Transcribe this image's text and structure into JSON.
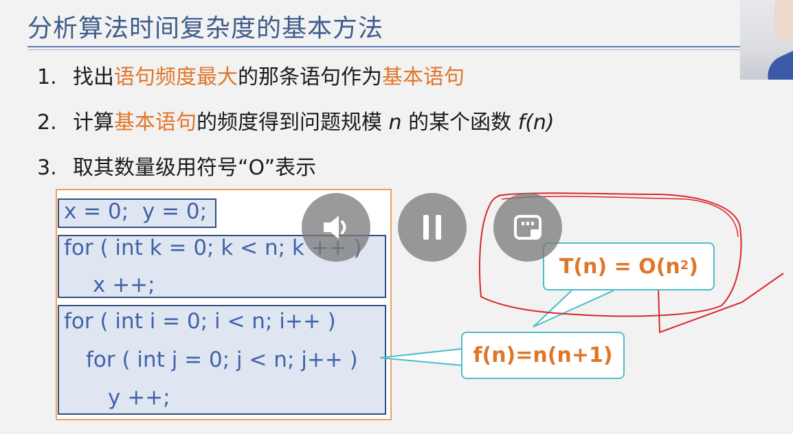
{
  "slide": {
    "title": "分析算法时间复杂度的基本方法",
    "steps": [
      {
        "num": "1.",
        "parts": [
          "找出",
          "语句频度最大",
          "的那条语句作为",
          "基本语句"
        ]
      },
      {
        "num": "2.",
        "parts": [
          "计算",
          "基本语句",
          "的频度得到问题规模 ",
          "n",
          " 的某个函数 ",
          "f(n)"
        ]
      },
      {
        "num": "3.",
        "parts": [
          "取其数量级用符号“O”表示"
        ]
      }
    ],
    "code": {
      "line1": "x = 0;  y = 0;",
      "line2": "for ( int k = 0; k < n; k ++ )",
      "line3": "x ++;",
      "line4": "for ( int i = 0; i < n; i++ )",
      "line5": "for ( int j = 0; j < n; j++ )",
      "line6": "y ++;"
    },
    "callout_f": "f(n)=n(n+1)",
    "callout_t_main": "T(n) = O(n",
    "callout_t_sup": "2",
    "callout_t_end": ")"
  },
  "player": {
    "volume_icon": "speaker-icon",
    "pause_icon": "pause-icon",
    "pip_icon": "picture-in-picture-icon"
  },
  "colors": {
    "title": "#3d5c8c",
    "highlight": "#e0762a",
    "code_text": "#3f63a8",
    "callout_border": "#4bbccc",
    "annotation": "#d9262c"
  }
}
